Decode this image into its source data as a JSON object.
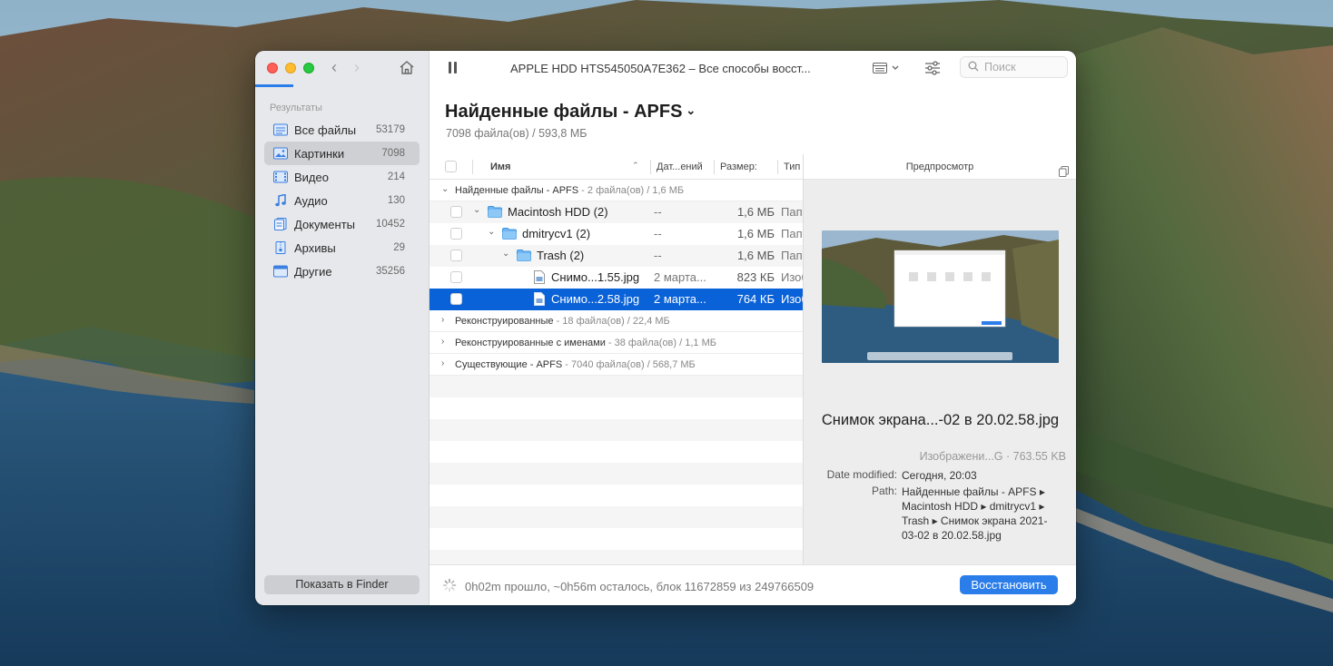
{
  "window": {
    "title": "APPLE HDD HTS545050A7E362 – Все способы восст...",
    "search_placeholder": "Поиск"
  },
  "sidebar": {
    "section_label": "Результаты",
    "items": [
      {
        "label": "Все файлы",
        "count": "53179",
        "icon": "all-files-icon"
      },
      {
        "label": "Картинки",
        "count": "7098",
        "icon": "pictures-icon",
        "active": true
      },
      {
        "label": "Видео",
        "count": "214",
        "icon": "video-icon"
      },
      {
        "label": "Аудио",
        "count": "130",
        "icon": "audio-icon"
      },
      {
        "label": "Документы",
        "count": "10452",
        "icon": "documents-icon"
      },
      {
        "label": "Архивы",
        "count": "29",
        "icon": "archives-icon"
      },
      {
        "label": "Другие",
        "count": "35256",
        "icon": "other-icon"
      }
    ],
    "finder_button": "Показать в Finder"
  },
  "main": {
    "heading": "Найденные файлы - APFS",
    "subheading": "7098 файла(ов) / 593,8 МБ",
    "columns": {
      "name": "Имя",
      "date": "Дат...ений",
      "size": "Размер:",
      "type": "Тип"
    },
    "groups": [
      {
        "title": "Найденные файлы - APFS",
        "detail": " - 2 файла(ов) / 1,6 МБ"
      },
      {
        "title": "Реконструированные",
        "detail": " - 18 файла(ов) / 22,4 МБ"
      },
      {
        "title": "Реконструированные с именами",
        "detail": " - 38 файла(ов) / 1,1 МБ"
      },
      {
        "title": "Существующие - APFS",
        "detail": " - 7040 файла(ов) / 568,7 МБ"
      }
    ],
    "rows": [
      {
        "name": "Macintosh HDD (2)",
        "date": "--",
        "size": "1,6 МБ",
        "type": "Папка"
      },
      {
        "name": "dmitrycv1 (2)",
        "date": "--",
        "size": "1,6 МБ",
        "type": "Папка"
      },
      {
        "name": "Trash (2)",
        "date": "--",
        "size": "1,6 МБ",
        "type": "Папка"
      },
      {
        "name": "Снимо...1.55.jpg",
        "date": "2 марта...",
        "size": "823 КБ",
        "type": "Изображение"
      },
      {
        "name": "Снимо...2.58.jpg",
        "date": "2 марта...",
        "size": "764 КБ",
        "type": "Изображение"
      }
    ]
  },
  "preview": {
    "header": "Предпросмотр",
    "filename": "Снимок экрана...-02 в 20.02.58.jpg",
    "kind_size": "Изображени...G · 763.55 KB",
    "date_label": "Date modified:",
    "date_value": "Сегодня, 20:03",
    "path_label": "Path:",
    "path_value": "Найденные файлы - APFS ▸ Macintosh HDD ▸ dmitrycv1 ▸ Trash ▸ Снимок экрана 2021-03-02 в 20.02.58.jpg"
  },
  "status": {
    "text": "0h02m прошло, ~0h56m осталось, блок 11672859 из 249766509",
    "restore_button": "Восстановить"
  },
  "colors": {
    "accent": "#2b7de9",
    "selection": "#0a62d8"
  }
}
